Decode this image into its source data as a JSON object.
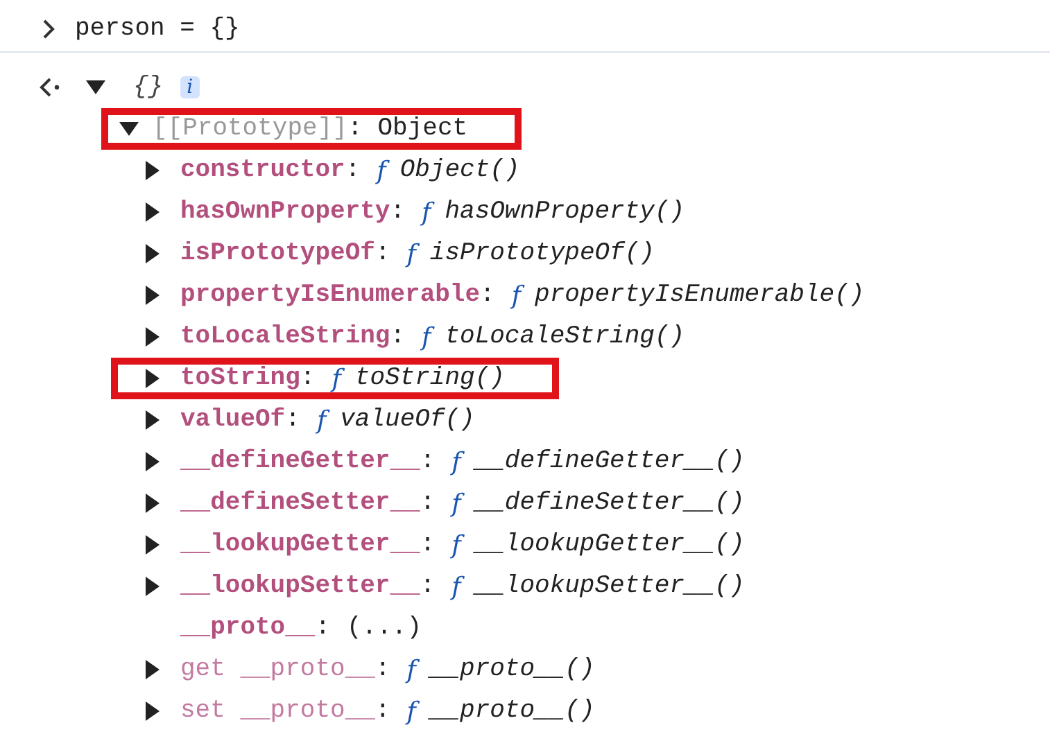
{
  "console": {
    "input": {
      "code": "person = {}"
    },
    "result": {
      "preview": "{}",
      "info_badge": "i",
      "expanded": true,
      "prototype": {
        "key": "[[Prototype]]",
        "sep": ":",
        "value": "Object",
        "expanded": true,
        "highlighted": true,
        "properties": [
          {
            "key": "constructor",
            "sep": ":",
            "kind": "method",
            "fn": "f",
            "value": "Object()",
            "highlighted": false
          },
          {
            "key": "hasOwnProperty",
            "sep": ":",
            "kind": "method",
            "fn": "f",
            "value": "hasOwnProperty()",
            "highlighted": false
          },
          {
            "key": "isPrototypeOf",
            "sep": ":",
            "kind": "method",
            "fn": "f",
            "value": "isPrototypeOf()",
            "highlighted": false
          },
          {
            "key": "propertyIsEnumerable",
            "sep": ":",
            "kind": "method",
            "fn": "f",
            "value": "propertyIsEnumerable()",
            "highlighted": false
          },
          {
            "key": "toLocaleString",
            "sep": ":",
            "kind": "method",
            "fn": "f",
            "value": "toLocaleString()",
            "highlighted": false
          },
          {
            "key": "toString",
            "sep": ":",
            "kind": "method",
            "fn": "f",
            "value": "toString()",
            "highlighted": true
          },
          {
            "key": "valueOf",
            "sep": ":",
            "kind": "method",
            "fn": "f",
            "value": "valueOf()",
            "highlighted": false
          },
          {
            "key": "__defineGetter__",
            "sep": ":",
            "kind": "method",
            "fn": "f",
            "value": "__defineGetter__()",
            "highlighted": false
          },
          {
            "key": "__defineSetter__",
            "sep": ":",
            "kind": "method",
            "fn": "f",
            "value": "__defineSetter__()",
            "highlighted": false
          },
          {
            "key": "__lookupGetter__",
            "sep": ":",
            "kind": "method",
            "fn": "f",
            "value": "__lookupGetter__()",
            "highlighted": false
          },
          {
            "key": "__lookupSetter__",
            "sep": ":",
            "kind": "method",
            "fn": "f",
            "value": "__lookupSetter__()",
            "highlighted": false
          },
          {
            "key": "__proto__",
            "sep": ":",
            "kind": "lazy",
            "value": "(...)",
            "highlighted": false
          },
          {
            "key": "get __proto__",
            "sep": ":",
            "kind": "accessor",
            "fn": "f",
            "value": "__proto__()",
            "highlighted": false
          },
          {
            "key": "set __proto__",
            "sep": ":",
            "kind": "accessor",
            "fn": "f",
            "value": "__proto__()",
            "highlighted": false
          }
        ]
      }
    }
  }
}
